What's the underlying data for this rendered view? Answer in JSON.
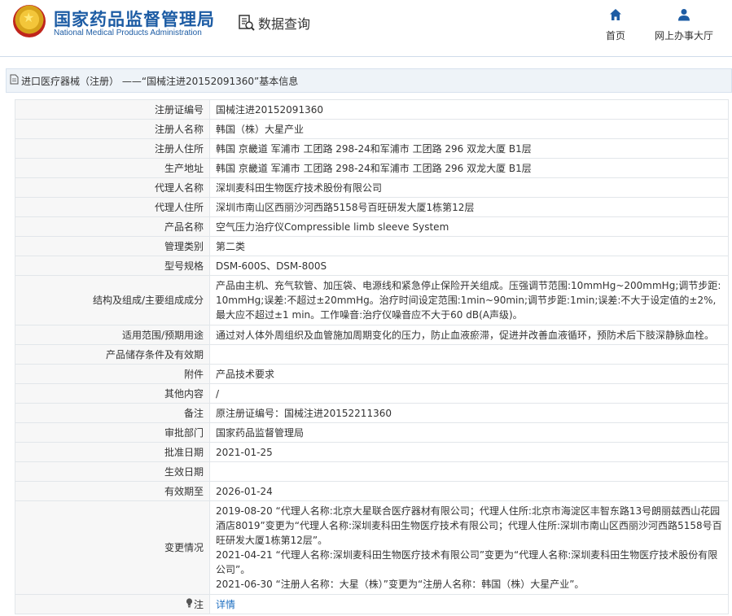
{
  "header": {
    "org_name_cn": "国家药品监督管理局",
    "org_name_en": "National Medical Products Administration",
    "data_query_label": "数据查询",
    "nav_home_label": "首页",
    "nav_office_label": "网上办事大厅"
  },
  "title_bar": {
    "text": "进口医疗器械（注册） ——“国械注进20152091360”基本信息"
  },
  "fields": {
    "reg_no": {
      "label": "注册证编号",
      "value": "国械注进20152091360"
    },
    "registrant_name": {
      "label": "注册人名称",
      "value": "韩国（株）大星产业"
    },
    "registrant_address": {
      "label": "注册人住所",
      "value": "韩国 京畿道 军浦市 工团路 298-24和军浦市 工团路 296 双龙大厦 B1层"
    },
    "production_address": {
      "label": "生产地址",
      "value": "韩国 京畿道 军浦市 工团路 298-24和军浦市 工团路 296 双龙大厦 B1层"
    },
    "agent_name": {
      "label": "代理人名称",
      "value": "深圳麦科田生物医疗技术股份有限公司"
    },
    "agent_address": {
      "label": "代理人住所",
      "value": "深圳市南山区西丽沙河西路5158号百旺研发大厦1栋第12层"
    },
    "product_name": {
      "label": "产品名称",
      "value": "空气压力治疗仪Compressible limb sleeve System"
    },
    "management_class": {
      "label": "管理类别",
      "value": "第二类"
    },
    "model": {
      "label": "型号规格",
      "value": "DSM-600S、DSM-800S"
    },
    "structure": {
      "label": "结构及组成/主要组成成分",
      "value": "产品由主机、充气软管、加压袋、电源线和紧急停止保险开关组成。压强调节范围:10mmHg~200mmHg;调节步距:10mmHg;误差:不超过±20mmHg。治疗时间设定范围:1min~90min;调节步距:1min;误差:不大于设定值的±2%,最大应不超过±1 min。工作噪音:治疗仪噪音应不大于60 dB(A声级)。"
    },
    "scope": {
      "label": "适用范围/预期用途",
      "value": "通过对人体外周组织及血管施加周期变化的压力，防止血液瘀滞，促进并改善血液循环，预防术后下肢深静脉血栓。"
    },
    "storage": {
      "label": "产品储存条件及有效期",
      "value": ""
    },
    "attachment": {
      "label": "附件",
      "value": "产品技术要求"
    },
    "other": {
      "label": "其他内容",
      "value": "/"
    },
    "remark": {
      "label": "备注",
      "value": "原注册证编号：国械注进20152211360"
    },
    "approval_dept": {
      "label": "审批部门",
      "value": "国家药品监督管理局"
    },
    "approval_date": {
      "label": "批准日期",
      "value": "2021-01-25"
    },
    "effective_date": {
      "label": "生效日期",
      "value": ""
    },
    "expiry_date": {
      "label": "有效期至",
      "value": "2026-01-24"
    },
    "changes": {
      "label": "变更情况",
      "entries": [
        "2019-08-20 “代理人名称:北京大星联合医疗器材有限公司；代理人住所:北京市海淀区丰智东路13号朗丽兹西山花园酒店8019”变更为“代理人名称:深圳麦科田生物医疗技术有限公司；代理人住所:深圳市南山区西丽沙河西路5158号百旺研发大厦1栋第12层”。",
        "2021-04-21 “代理人名称:深圳麦科田生物医疗技术有限公司”变更为“代理人名称:深圳麦科田生物医疗技术股份有限公司”。",
        "2021-06-30 “注册人名称：大星（株）”变更为“注册人名称：韩国（株）大星产业”。"
      ]
    },
    "note": {
      "label": "注",
      "value": "详情"
    }
  },
  "colors": {
    "brand_blue": "#1d5ca4",
    "link_blue": "#1e6fc1",
    "label_bg": "#f7f7f7",
    "title_bar_bg": "#eef3f8"
  },
  "icons": {
    "emblem": "national-emblem-icon",
    "data_query": "document-search-icon",
    "home": "home-icon",
    "office": "user-icon",
    "title_bar": "document-icon",
    "note": "lightbulb-icon"
  }
}
